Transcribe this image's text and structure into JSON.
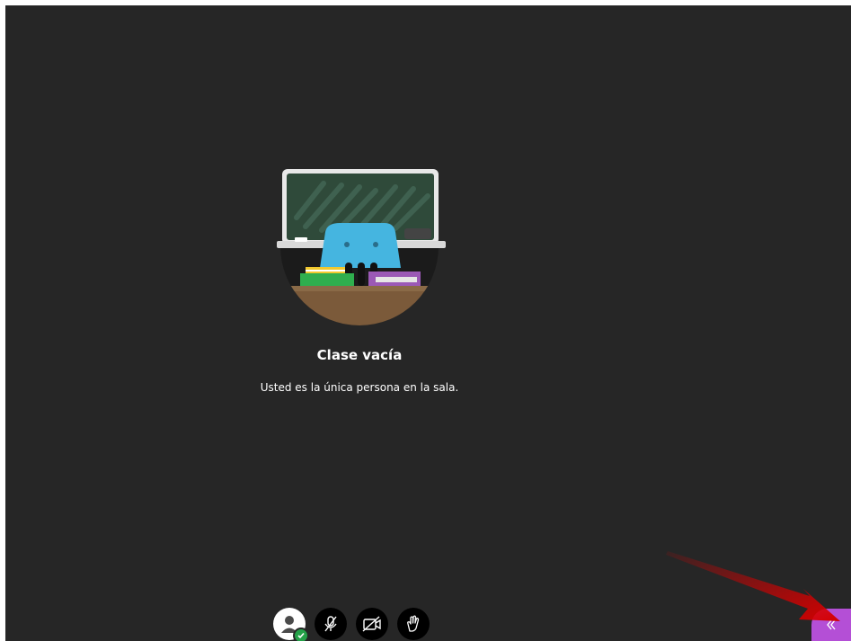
{
  "empty_state": {
    "title": "Clase vacía",
    "subtitle": "Usted es la única persona en la sala."
  },
  "controls": [
    {
      "name": "avatar",
      "icon": "user-avatar-icon",
      "status": "online-check-icon"
    },
    {
      "name": "microphone",
      "icon": "microphone-off-icon"
    },
    {
      "name": "camera",
      "icon": "camera-off-icon"
    },
    {
      "name": "hand",
      "icon": "raise-hand-icon"
    }
  ],
  "panel_toggle": {
    "icon": "double-chevron-left-icon"
  },
  "colors": {
    "background": "#262626",
    "accent": "#b44fd6",
    "status_online": "#24a148",
    "annotation_arrow": "#e00000"
  }
}
